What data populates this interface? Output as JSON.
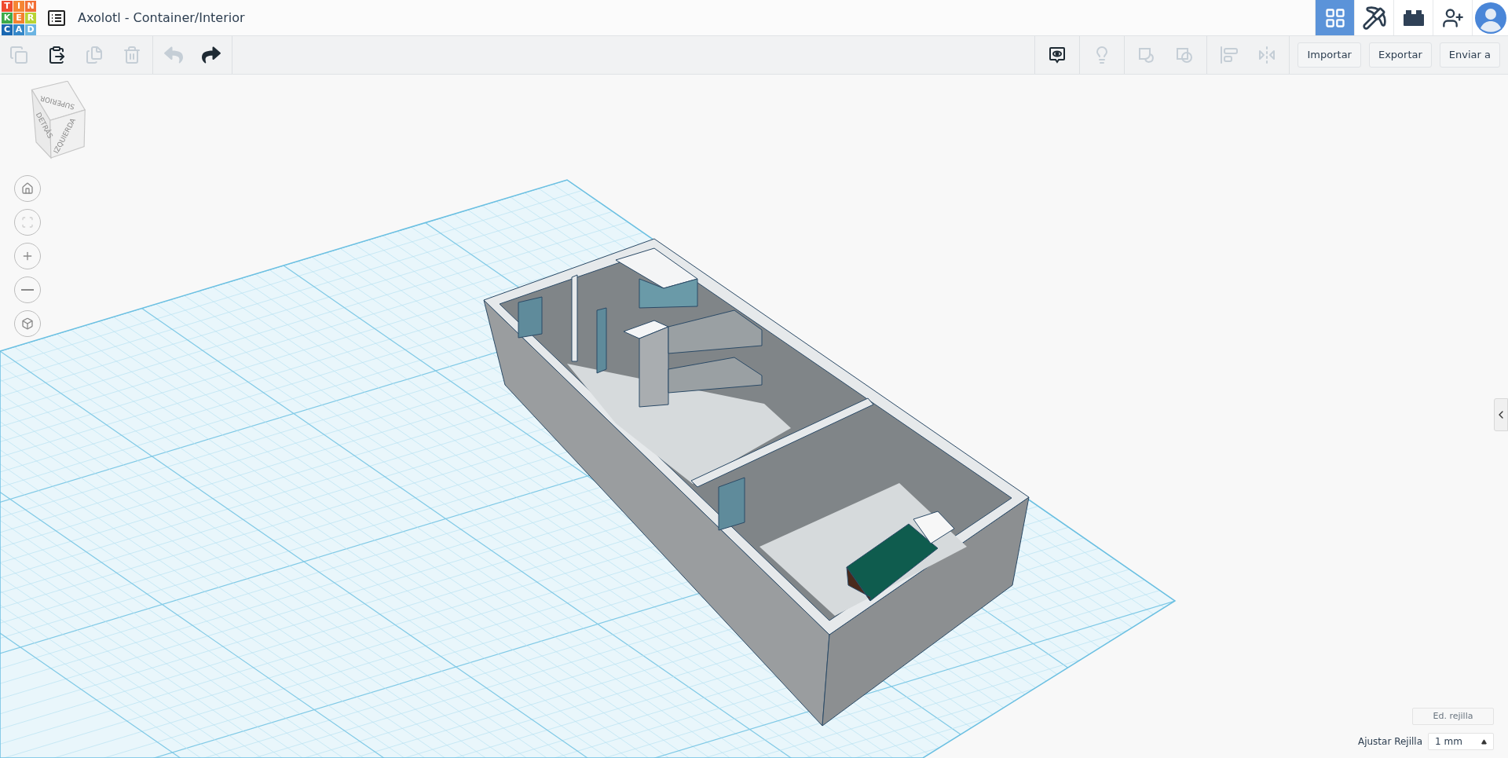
{
  "header": {
    "logo_letters": [
      {
        "letter": "T",
        "color": "#ef4b2f"
      },
      {
        "letter": "I",
        "color": "#f58634"
      },
      {
        "letter": "N",
        "color": "#f26f35"
      },
      {
        "letter": "K",
        "color": "#3daa4a"
      },
      {
        "letter": "E",
        "color": "#f4812f"
      },
      {
        "letter": "R",
        "color": "#b9d334"
      },
      {
        "letter": "C",
        "color": "#1a68b2"
      },
      {
        "letter": "A",
        "color": "#3487c9"
      },
      {
        "letter": "D",
        "color": "#6bb4e2"
      }
    ],
    "title": "Axolotl - Container/Interior",
    "nav": [
      {
        "kind": "grid",
        "selected": true
      },
      {
        "kind": "pickaxe",
        "selected": false
      },
      {
        "kind": "brick",
        "selected": false
      },
      {
        "kind": "add-user",
        "selected": false
      },
      {
        "kind": "avatar",
        "selected": false
      }
    ]
  },
  "toolbar": {
    "edit_tools": [
      {
        "kind": "copy",
        "disabled": true
      },
      {
        "kind": "paste",
        "disabled": false
      },
      {
        "kind": "duplicate",
        "disabled": true
      },
      {
        "kind": "delete",
        "disabled": true
      }
    ],
    "history": [
      {
        "kind": "undo",
        "disabled": true
      },
      {
        "kind": "redo",
        "disabled": false
      }
    ],
    "view_tools": [
      {
        "kind": "notes",
        "disabled": false
      },
      {
        "kind": "light",
        "disabled": true
      },
      {
        "kind": "group",
        "disabled": true
      },
      {
        "kind": "ungroup",
        "disabled": true
      },
      {
        "kind": "align",
        "disabled": true
      },
      {
        "kind": "mirror",
        "disabled": true
      }
    ],
    "buttons": [
      "Importar",
      "Exportar",
      "Enviar a"
    ]
  },
  "view_cube": {
    "faces": [
      "SUPERIOR",
      "DETRÁS",
      "IZQUIERDA"
    ]
  },
  "view_controls": [
    {
      "kind": "home",
      "disabled": false
    },
    {
      "kind": "fit",
      "disabled": true
    },
    {
      "kind": "zoom-in",
      "disabled": false
    },
    {
      "kind": "zoom-out",
      "disabled": false
    },
    {
      "kind": "perspective",
      "disabled": false
    }
  ],
  "grid_controls": {
    "edit_button": "Ed. rejilla",
    "snap_label": "Ajustar Rejilla",
    "snap_value": "1 mm"
  }
}
